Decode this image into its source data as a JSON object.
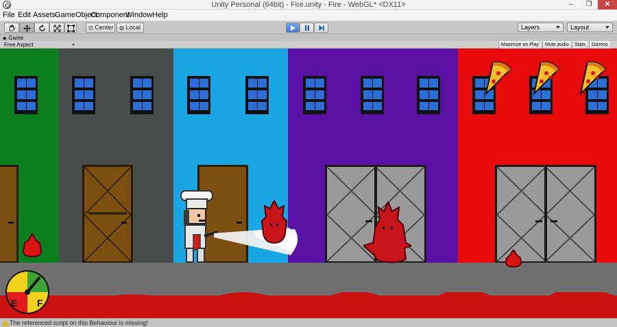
{
  "window": {
    "title": "Unity Personal (64bit) - Fire.unity - Fire - WebGL* <DX11>",
    "minimize": "‒",
    "maximize": "❐",
    "close": "✕"
  },
  "menu": [
    "File",
    "Edit",
    "Assets",
    "GameObject",
    "Component",
    "Window",
    "Help"
  ],
  "toolbar": {
    "tools": [
      "hand-tool",
      "move-tool",
      "rotate-tool",
      "scale-tool",
      "rect-tool"
    ],
    "pivot_center": "Center",
    "pivot_local": "Local",
    "layers": "Layers",
    "layout": "Layout"
  },
  "game_view": {
    "tab": "Game",
    "aspect": "Free Aspect",
    "maximize_on_play": "Maximize on Play",
    "mute_audio": "Mute audio",
    "stats": "Stats",
    "gizmos": "Gizmos"
  },
  "hud": {
    "gauge_left": "E",
    "gauge_right": "F"
  },
  "status": {
    "message": "The referenced script on this Behaviour is missing!"
  },
  "colors": {
    "building_green": "#0b7e1e",
    "building_gray": "#474d4a",
    "building_blue": "#1aa6e3",
    "building_purple": "#5a12a4",
    "building_red": "#e60a0a",
    "window_blue": "#2b6fd6",
    "door_brown": "#7a4f10"
  }
}
